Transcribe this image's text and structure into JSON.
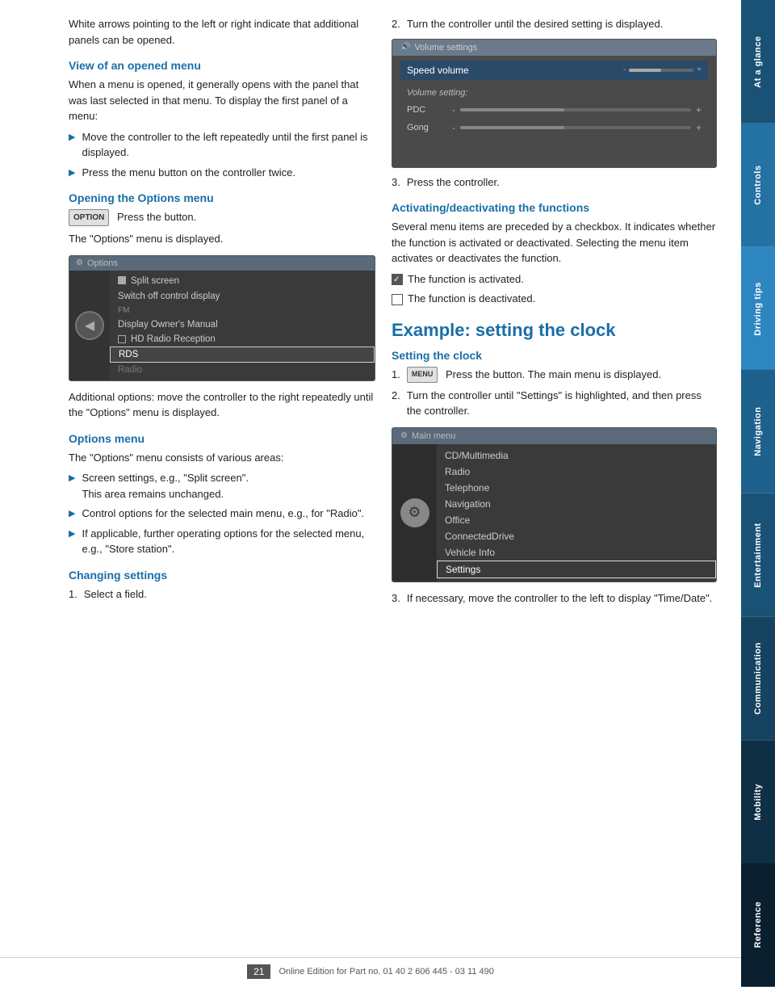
{
  "sidebar": {
    "items": [
      {
        "label": "At a glance",
        "class": "sidebar-item-1"
      },
      {
        "label": "Controls",
        "class": "sidebar-item-2"
      },
      {
        "label": "Driving tips",
        "class": "sidebar-item-3"
      },
      {
        "label": "Navigation",
        "class": "sidebar-item-4"
      },
      {
        "label": "Entertainment",
        "class": "sidebar-item-5"
      },
      {
        "label": "Communication",
        "class": "sidebar-item-6"
      },
      {
        "label": "Mobility",
        "class": "sidebar-item-7"
      },
      {
        "label": "Reference",
        "class": "sidebar-item-8"
      }
    ]
  },
  "left_col": {
    "intro_text": "White arrows pointing to the left or right indicate that additional panels can be opened.",
    "section1_heading": "View of an opened menu",
    "section1_text": "When a menu is opened, it generally opens with the panel that was last selected in that menu. To display the first panel of a menu:",
    "bullet1": "Move the controller to the left repeatedly until the first panel is displayed.",
    "bullet2": "Press the menu button on the controller twice.",
    "section2_heading": "Opening the Options menu",
    "option_btn_label": "OPTION",
    "option_instruction": "Press the button.",
    "options_displayed": "The \"Options\" menu is displayed.",
    "options_mockup": {
      "header": "Options",
      "rows": [
        {
          "text": "Split screen",
          "type": "normal"
        },
        {
          "text": "Switch off control display",
          "type": "normal"
        },
        {
          "text": "FM",
          "type": "section"
        },
        {
          "text": "Display Owner's Manual",
          "type": "normal"
        },
        {
          "text": "HD Radio Reception",
          "type": "checkbox"
        },
        {
          "text": "RDS",
          "type": "highlighted"
        },
        {
          "text": "Radio",
          "type": "dimmed"
        }
      ]
    },
    "additional_options_text": "Additional options: move the controller to the right repeatedly until the \"Options\" menu is displayed.",
    "section3_heading": "Options menu",
    "options_menu_intro": "The \"Options\" menu consists of various areas:",
    "options_bullets": [
      "Screen settings, e.g., \"Split screen\".\nThis area remains unchanged.",
      "Control options for the selected main menu, e.g., for \"Radio\".",
      "If applicable, further operating options for the selected menu, e.g., \"Store station\"."
    ],
    "section4_heading": "Changing settings",
    "step1": "Select a field."
  },
  "right_col": {
    "step2": "Turn the controller until the desired setting is displayed.",
    "step3": "Press the controller.",
    "volume_mockup": {
      "header": "Volume settings",
      "selected_item": "Speed volume",
      "slider_rows": [
        {
          "label": "Volume setting:",
          "type": "header"
        },
        {
          "label": "PDC",
          "fill": 45
        },
        {
          "label": "Gong",
          "fill": 45
        }
      ]
    },
    "section5_heading": "Activating/deactivating the functions",
    "section5_text": "Several menu items are preceded by a checkbox. It indicates whether the function is activated or deactivated. Selecting the menu item activates or deactivates the function.",
    "activated_label": "The function is activated.",
    "deactivated_label": "The function is deactivated.",
    "big_heading": "Example: setting the clock",
    "section6_heading": "Setting the clock",
    "clock_step1": "Press the button. The main menu is displayed.",
    "clock_step2": "Turn the controller until \"Settings\" is highlighted, and then press the controller.",
    "main_menu_mockup": {
      "header": "Main menu",
      "rows": [
        "CD/Multimedia",
        "Radio",
        "Telephone",
        "Navigation",
        "Office",
        "ConnectedDrive",
        "Vehicle Info",
        "Settings"
      ]
    },
    "clock_step3": "If necessary, move the controller to the left to display \"Time/Date\".",
    "menu_btn_label": "MENU"
  },
  "footer": {
    "page_number": "21",
    "footer_text": "Online Edition for Part no. 01 40 2 606 445 - 03 11 490"
  }
}
